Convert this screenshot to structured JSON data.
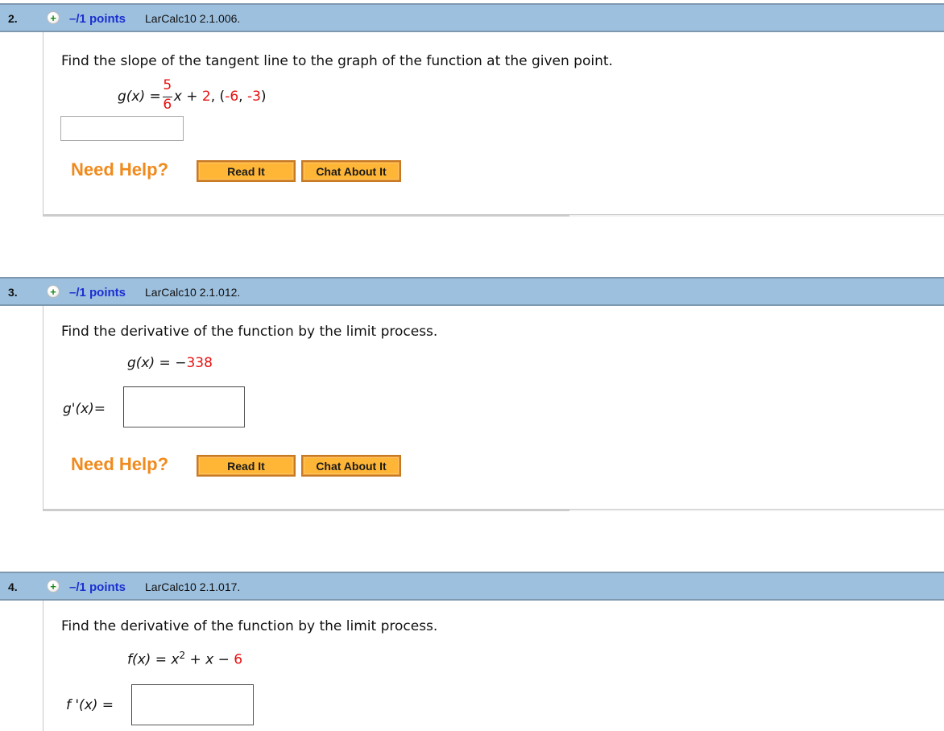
{
  "questions": [
    {
      "number": "2.",
      "icon": "plus-circle-icon",
      "points": "–/1 points",
      "reference": "LarCalc10 2.1.006.",
      "prompt": "Find the slope of the tangent line to the graph of the function at the given point.",
      "function": {
        "lhs": "g(x)",
        "equals": "=",
        "frac_num": "5",
        "frac_den": "6",
        "var": "x",
        "plus": "+",
        "const": "2",
        "sep": ",",
        "point_open": "(",
        "point_x": "-6",
        "point_comma": ",",
        "point_y": "-3",
        "point_close": ")"
      },
      "answer_value": "",
      "help_label": "Need Help?",
      "read_it": "Read It",
      "chat_about_it": "Chat About It"
    },
    {
      "number": "3.",
      "icon": "plus-circle-icon",
      "points": "–/1 points",
      "reference": "LarCalc10 2.1.012.",
      "prompt": "Find the derivative of the function by the limit process.",
      "function": {
        "lhs": "g(x)",
        "equals": "=",
        "minus": "−",
        "value": "338"
      },
      "answer_label": "g'(x)=",
      "answer_value": "",
      "help_label": "Need Help?",
      "read_it": "Read It",
      "chat_about_it": "Chat About It"
    },
    {
      "number": "4.",
      "icon": "plus-circle-icon",
      "points": "–/1 points",
      "reference": "LarCalc10 2.1.017.",
      "prompt": "Find the derivative of the function by the limit process.",
      "function": {
        "lhs": "f(x)",
        "equals": "=",
        "base": "x",
        "exponent": "2",
        "plus": "+",
        "var": "x",
        "minus": "−",
        "const": "6"
      },
      "answer_label": "f '(x) =",
      "answer_value": ""
    }
  ]
}
